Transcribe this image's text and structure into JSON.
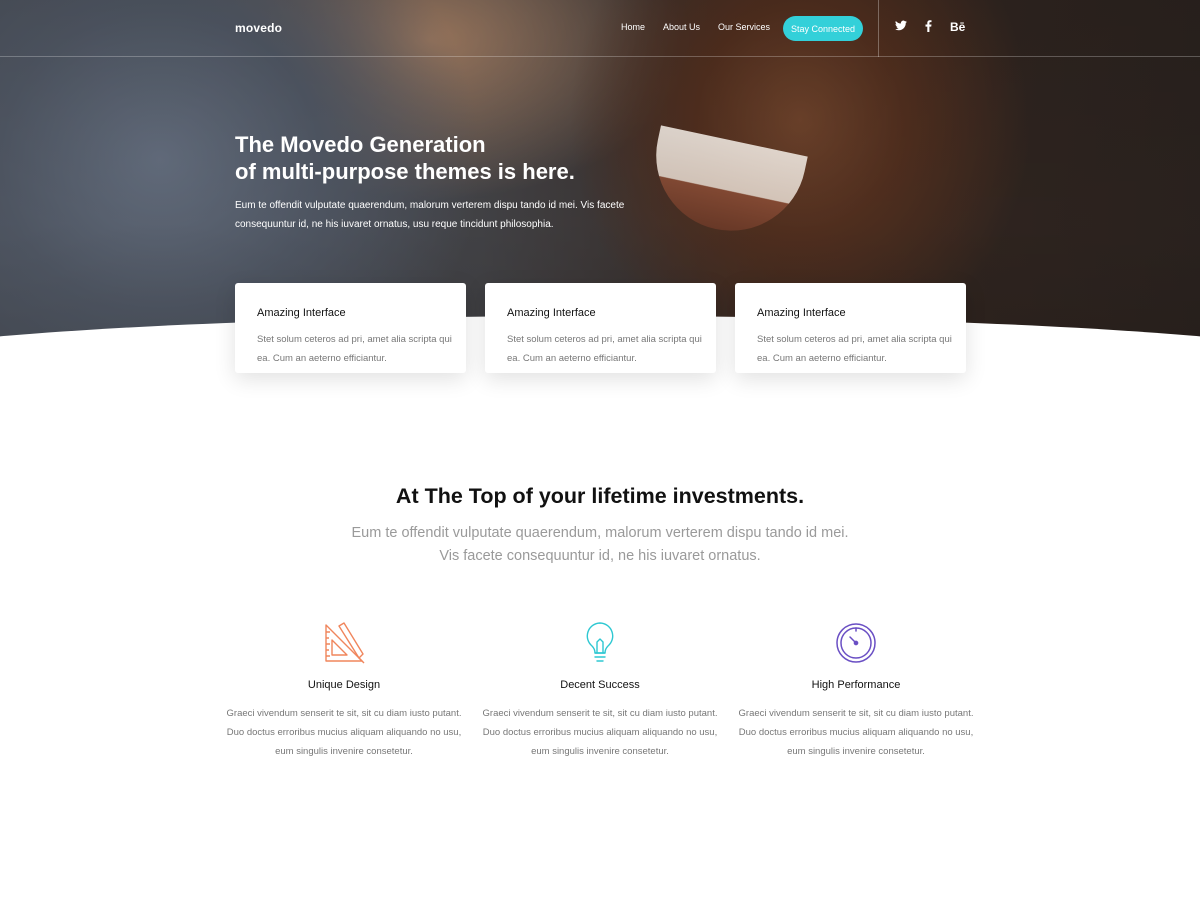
{
  "brand": {
    "logo_text": "movedo"
  },
  "nav": {
    "links": [
      "Home",
      "About Us",
      "Our Services"
    ],
    "cta_label": "Stay Connected",
    "social": {
      "twitter_icon": "twitter-icon",
      "facebook_icon": "facebook-icon",
      "behance_label": "Bē"
    }
  },
  "hero": {
    "title_line1": "The Movedo Generation",
    "title_line2": "of multi-purpose themes is here.",
    "subtitle": "Eum te offendit vulputate quaerendum, malorum verterem dispu tando id mei. Vis facete consequuntur id, ne his iuvaret ornatus, usu reque tincidunt philosophia."
  },
  "cards": [
    {
      "title": "Amazing Interface",
      "text": "Stet solum ceteros ad pri, amet alia scripta qui ea. Cum an aeterno efficiantur."
    },
    {
      "title": "Amazing Interface",
      "text": "Stet solum ceteros ad pri, amet alia scripta qui ea. Cum an aeterno efficiantur."
    },
    {
      "title": "Amazing Interface",
      "text": "Stet solum ceteros ad pri, amet alia scripta qui ea. Cum an aeterno efficiantur."
    }
  ],
  "section": {
    "title": "At The Top of your lifetime investments.",
    "subtitle": "Eum te offendit vulputate quaerendum, malorum verterem dispu tando id mei. Vis facete consequuntur id, ne his iuvaret ornatus."
  },
  "features": [
    {
      "icon": "ruler-triangle-icon",
      "title": "Unique Design",
      "text": "Graeci vivendum senserit te sit, sit cu diam iusto putant. Duo doctus erroribus mucius aliquam aliquando no usu, eum singulis invenire consetetur."
    },
    {
      "icon": "lightbulb-icon",
      "title": "Decent Success",
      "text": "Graeci vivendum senserit te sit, sit cu diam iusto putant. Duo doctus erroribus mucius aliquam aliquando no usu, eum singulis invenire consetetur."
    },
    {
      "icon": "speedometer-icon",
      "title": "High Performance",
      "text": "Graeci vivendum senserit te sit, sit cu diam iusto putant. Duo doctus erroribus mucius aliquam aliquando no usu, eum singulis invenire consetetur."
    }
  ],
  "colors": {
    "accent": "#33d0d9",
    "icon_design": "#f0855c",
    "icon_success": "#2ec8d2",
    "icon_performance": "#6a4fc4"
  }
}
